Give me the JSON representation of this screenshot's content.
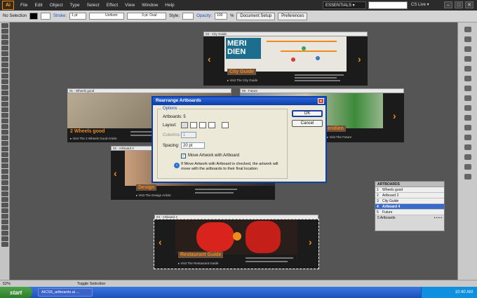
{
  "menubar": {
    "logo": "Ai",
    "items": [
      "File",
      "Edit",
      "Object",
      "Type",
      "Select",
      "Effect",
      "View",
      "Window",
      "Help"
    ],
    "workspace": "ESSENTIALS ▾",
    "cslive": "CS Live ▾"
  },
  "control": {
    "selection": "No Selection",
    "stroke_label": "Stroke:",
    "stroke_value": "1 pt",
    "profile": "Uniform",
    "brush": "3 pt. Oval",
    "style_label": "Style:",
    "opacity_label": "Opacity:",
    "opacity_value": "100",
    "pct": "%",
    "doc_setup": "Document Setup",
    "preferences": "Preferences"
  },
  "artboards": {
    "a1": {
      "label": "03 - City Guide",
      "big": "MERI DIEN",
      "tag": "City Guide",
      "link": "▸ Visit The City Guide"
    },
    "a2": {
      "label": "01 - Wheels good",
      "tag": "2 Wheels good",
      "link": "▸ Visit The 2 Wheels Good Article"
    },
    "a3": {
      "label": "05 - Future",
      "tag": "eridien",
      "link": "▸ Visit The Future"
    },
    "a4": {
      "label": "02 - Artboard 2",
      "tag": "Design",
      "link": "▸ Visit The Design Article"
    },
    "a5": {
      "label": "04 - Artboard 4",
      "tag": "Restaurant Guide",
      "link": "▸ Visit The Restaurant Guide"
    }
  },
  "dialog": {
    "title": "Rearrange Artboards",
    "options": "Options",
    "artboards_count": "Artboards: 5",
    "layout_label": "Layout:",
    "columns_label": "Columns:",
    "columns_value": "1",
    "spacing_label": "Spacing:",
    "spacing_value": "20 pt",
    "move_checkbox": "Move Artwork with Artboard",
    "info": "If Move Artwork with Artboard is checked, the artwork will move with the artboards to their final location.",
    "ok": "OK",
    "cancel": "Cancel"
  },
  "ab_panel": {
    "title": "ARTBOARDS",
    "rows": [
      {
        "n": "1",
        "name": "Wheels good"
      },
      {
        "n": "2",
        "name": "Artboard 2"
      },
      {
        "n": "3",
        "name": "City Guide"
      },
      {
        "n": "4",
        "name": "Artboard 4"
      },
      {
        "n": "5",
        "name": "Future"
      }
    ],
    "selected_index": 3,
    "footer": "5 Artboards"
  },
  "status": {
    "zoom": "52%",
    "tool": "Toggle Selection"
  },
  "taskbar": {
    "start": "start",
    "task": "AICS5_artboards.ai ...",
    "time": "10:40 AM"
  },
  "colors": {
    "accent": "#f08c1c",
    "selection": "#3a6bc9",
    "taskbar": "#1f4fb8"
  }
}
